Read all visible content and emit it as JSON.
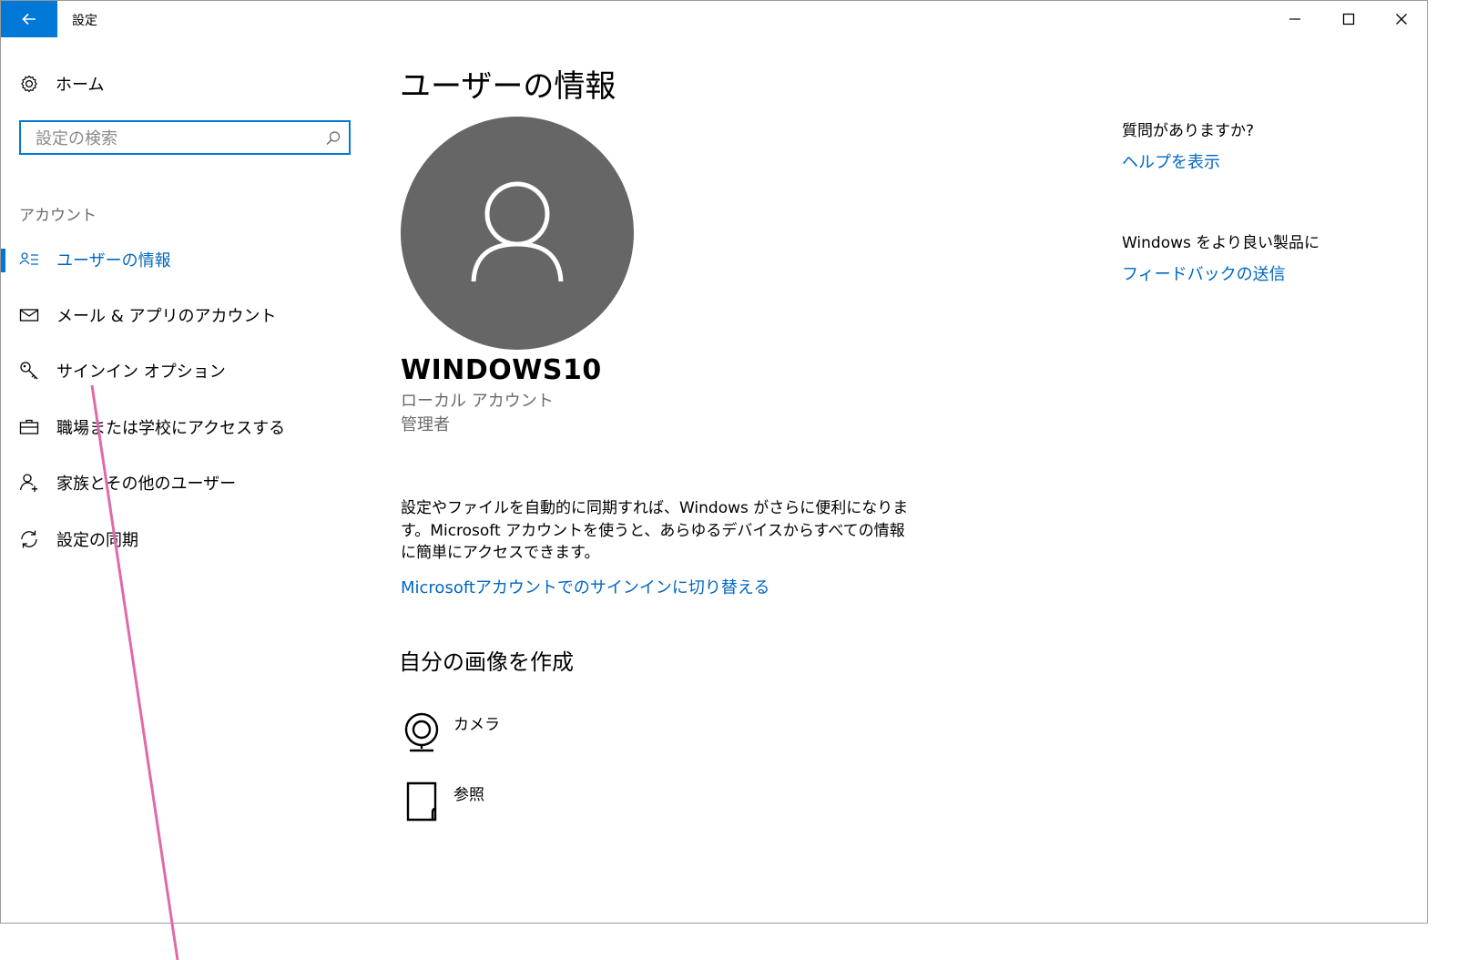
{
  "window": {
    "title": "設定"
  },
  "colors": {
    "accent": "#0078d7",
    "link": "#0067c0",
    "avatar_bg": "#666666",
    "annotation": "#e06aa8"
  },
  "sidebar": {
    "home_label": "ホーム",
    "search_placeholder": "設定の検索",
    "section_label": "アカウント",
    "items": [
      {
        "label": "ユーザーの情報",
        "icon": "user-info-icon",
        "active": true
      },
      {
        "label": "メール & アプリのアカウント",
        "icon": "mail-icon",
        "active": false
      },
      {
        "label": "サインイン オプション",
        "icon": "key-icon",
        "active": false
      },
      {
        "label": "職場または学校にアクセスする",
        "icon": "briefcase-icon",
        "active": false
      },
      {
        "label": "家族とその他のユーザー",
        "icon": "add-person-icon",
        "active": false
      },
      {
        "label": "設定の同期",
        "icon": "sync-icon",
        "active": false
      }
    ]
  },
  "main": {
    "title": "ユーザーの情報",
    "user_name": "WINDOWS10",
    "account_type": "ローカル アカウント",
    "account_role": "管理者",
    "description": "設定やファイルを自動的に同期すれば、Windows がさらに便利になります。Microsoft アカウントを使うと、あらゆるデバイスからすべての情報に簡単にアクセスできます。",
    "switch_link": "Microsoftアカウントでのサインインに切り替える",
    "picture_section_title": "自分の画像を作成",
    "picture_options": [
      {
        "label": "カメラ",
        "icon": "webcam-icon"
      },
      {
        "label": "参照",
        "icon": "browse-file-icon"
      }
    ]
  },
  "right_panel": {
    "question": "質問がありますか?",
    "help_link": "ヘルプを表示",
    "better_text": "Windows をより良い製品に",
    "feedback_link": "フィードバックの送信"
  }
}
